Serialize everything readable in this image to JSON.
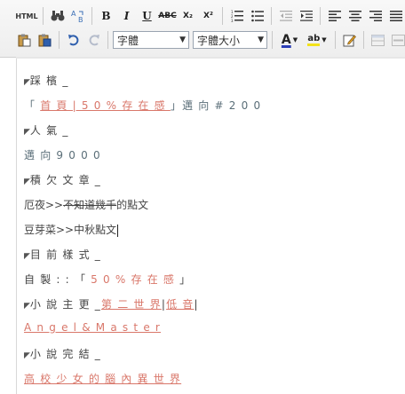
{
  "toolbar": {
    "row1": {
      "html_label": "HTML",
      "find_label": "A",
      "replace_label": "AB",
      "bold_label": "B",
      "italic_label": "I",
      "underline_label": "U",
      "strike_label": "ABC",
      "subscript_label": "X₂",
      "superscript_label": "X²"
    },
    "row2": {
      "font_select": "字體",
      "size_select": "字體大小",
      "font_color_label": "A",
      "highlight_label": "ab"
    }
  },
  "content": {
    "sections": [
      {
        "heading_mark": "◤",
        "heading": "踩 檳 _"
      },
      {
        "line1_open": "「 ",
        "line1_link": "首 頁 | 5 0 % 存 在 感 ",
        "line1_close": "」",
        "line1_rest": "邁 向 # 2 0 0"
      },
      {
        "heading_mark": "◤",
        "heading": "人 氣 _"
      },
      {
        "text": "邁 向 9 0 0 0"
      },
      {
        "heading_mark": "◤",
        "heading": "積 欠 文 章 _"
      },
      {
        "prefix": "厄夜>>",
        "struck": "不知道幾千",
        "suffix": "的點文"
      },
      {
        "text": "豆芽菜>>中秋點文"
      },
      {
        "heading_mark": "◤",
        "heading": "目 前 樣 式 _"
      },
      {
        "prefix": " 自 製 : : 「 ",
        "highlight": "5 0 % 存 在 感",
        "suffix": " 」"
      },
      {
        "heading_mark": "◤",
        "heading": "小 說 主 更 _",
        "link1": "第 二 世 界",
        "sep1": "|",
        "link2": "低 音",
        "sep2": "|"
      },
      {
        "link": "A n g e l & M a s t e r"
      },
      {
        "heading_mark": "◤",
        "heading": "小 說 完 結 _"
      },
      {
        "link": "高 校 少 女 的 腦 內 異 世 界"
      }
    ]
  }
}
